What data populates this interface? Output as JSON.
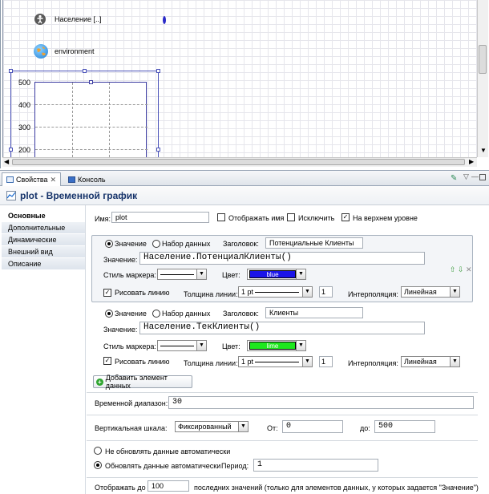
{
  "editor": {
    "items": [
      {
        "name": "population-item",
        "label": "Население [..]",
        "icon": "stick-figure-icon"
      },
      {
        "name": "environment-item",
        "label": "environment",
        "icon": "globe-icon"
      }
    ],
    "chart_data": {
      "type": "line",
      "title": "",
      "xlabel": "",
      "ylabel": "",
      "yticks": [
        500,
        400,
        300,
        200
      ],
      "x": [],
      "series": []
    }
  },
  "tabs": [
    {
      "label": "Свойства",
      "icon": "properties-icon"
    },
    {
      "label": "Консоль",
      "icon": "console-icon"
    }
  ],
  "panel_title": "plot - Временной график",
  "sidebar": [
    {
      "label": "Основные"
    },
    {
      "label": "Дополнительные"
    },
    {
      "label": "Динамические"
    },
    {
      "label": "Внешний вид"
    },
    {
      "label": "Описание"
    }
  ],
  "form": {
    "name_label": "Имя:",
    "name_value": "plot",
    "show_name": "Отображать имя",
    "exclude": "Исключить",
    "top_level": "На верхнем уровне",
    "datasets": [
      {
        "mode_value": "Значение",
        "mode_dataset": "Набор данных",
        "title_label": "Заголовок:",
        "title_value": "Потенциальные Клиенты",
        "value_label": "Значение:",
        "value_expr": "Население.ПотенциалКлиенты()",
        "marker_label": "Стиль маркера:",
        "color_label": "Цвет:",
        "color_name": "blue",
        "color_hex": "#1a14e8",
        "draw_line": "Рисовать линию",
        "thickness_label": "Толщина линии:",
        "thickness_value": "1 pt",
        "thickness_num": "1",
        "interp_label": "Интерполяция:",
        "interp_value": "Линейная"
      },
      {
        "mode_value": "Значение",
        "mode_dataset": "Набор данных",
        "title_label": "Заголовок:",
        "title_value": "Клиенты",
        "value_label": "Значение:",
        "value_expr": "Население.ТекКлиенты()",
        "marker_label": "Стиль маркера:",
        "color_label": "Цвет:",
        "color_name": "lime",
        "color_hex": "#1ee81e",
        "draw_line": "Рисовать линию",
        "thickness_label": "Толщина линии:",
        "thickness_value": "1 pt",
        "thickness_num": "1",
        "interp_label": "Интерполяция:",
        "interp_value": "Линейная"
      }
    ],
    "add_dataset": "Добавить элемент данных",
    "time_range_label": "Временной диапазон:",
    "time_range_value": "30",
    "vscale_label": "Вертикальная шкала:",
    "vscale_value": "Фиксированный",
    "from_label": "От:",
    "from_value": "0",
    "to_label": "до:",
    "to_value": "500",
    "no_auto_update": "Не обновлять данные автоматически",
    "auto_update": "Обновлять данные автоматически",
    "period_label": "Период:",
    "period_value": "1",
    "show_last_label": "Отображать до",
    "show_last_value": "100",
    "show_last_suffix": "последних значений (только для элементов данных, у которых задается \"Значение\")"
  }
}
